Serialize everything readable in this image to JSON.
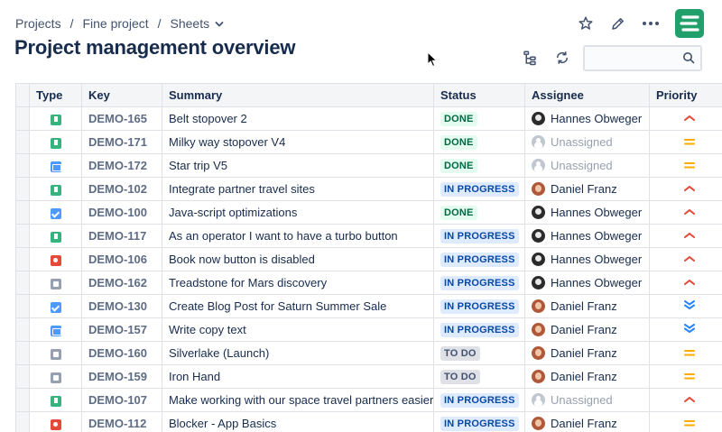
{
  "breadcrumb": {
    "projects": "Projects",
    "project": "Fine project",
    "sheets": "Sheets",
    "separator": "/"
  },
  "page_title": "Project management overview",
  "search": {
    "value": "",
    "placeholder": ""
  },
  "columns": {
    "type": "Type",
    "key": "Key",
    "summary": "Summary",
    "status": "Status",
    "assignee": "Assignee",
    "priority": "Priority"
  },
  "rows": [
    {
      "type": "story",
      "key": "DEMO-165",
      "summary": "Belt stopover 2",
      "status": "DONE",
      "assignee": "Hannes Obweger",
      "priority": "high"
    },
    {
      "type": "story",
      "key": "DEMO-171",
      "summary": "Milky way stopover V4",
      "status": "DONE",
      "assignee": "Unassigned",
      "priority": "medium"
    },
    {
      "type": "subtask",
      "key": "DEMO-172",
      "summary": "Star trip V5",
      "status": "DONE",
      "assignee": "Unassigned",
      "priority": "medium"
    },
    {
      "type": "story",
      "key": "DEMO-102",
      "summary": "Integrate partner travel sites",
      "status": "IN PROGRESS",
      "assignee": "Daniel Franz",
      "priority": "high"
    },
    {
      "type": "task",
      "key": "DEMO-100",
      "summary": "Java-script optimizations",
      "status": "DONE",
      "assignee": "Hannes Obweger",
      "priority": "high"
    },
    {
      "type": "story",
      "key": "DEMO-117",
      "summary": "As an operator I want to have a turbo button",
      "status": "IN PROGRESS",
      "assignee": "Hannes Obweger",
      "priority": "high"
    },
    {
      "type": "bug",
      "key": "DEMO-106",
      "summary": "Book now button is disabled",
      "status": "IN PROGRESS",
      "assignee": "Hannes Obweger",
      "priority": "high"
    },
    {
      "type": "epic",
      "key": "DEMO-162",
      "summary": "Treadstone for Mars discovery",
      "status": "IN PROGRESS",
      "assignee": "Hannes Obweger",
      "priority": "high"
    },
    {
      "type": "task",
      "key": "DEMO-130",
      "summary": "Create Blog Post for Saturn Summer Sale",
      "status": "IN PROGRESS",
      "assignee": "Daniel Franz",
      "priority": "lowest"
    },
    {
      "type": "subtask",
      "key": "DEMO-157",
      "summary": "Write copy text",
      "status": "IN PROGRESS",
      "assignee": "Daniel Franz",
      "priority": "lowest"
    },
    {
      "type": "epic",
      "key": "DEMO-160",
      "summary": "Silverlake (Launch)",
      "status": "TO DO",
      "assignee": "Daniel Franz",
      "priority": "medium"
    },
    {
      "type": "epic",
      "key": "DEMO-159",
      "summary": "Iron Hand",
      "status": "TO DO",
      "assignee": "Daniel Franz",
      "priority": "medium"
    },
    {
      "type": "story",
      "key": "DEMO-107",
      "summary": "Make working with our space travel partners easier",
      "status": "IN PROGRESS",
      "assignee": "Unassigned",
      "priority": "high"
    },
    {
      "type": "bug",
      "key": "DEMO-112",
      "summary": "Blocker - App Basics",
      "status": "IN PROGRESS",
      "assignee": "Daniel Franz",
      "priority": "medium"
    }
  ],
  "colors": {
    "accent": "#22a06b",
    "priority_high": "#e5493a",
    "priority_medium": "#ffab00",
    "priority_low": "#2684ff"
  },
  "icons": {
    "star": "star-icon",
    "edit": "pencil-icon",
    "more": "more-icon",
    "hierarchy": "hierarchy-icon",
    "refresh": "refresh-icon",
    "search": "search-icon",
    "logo": "sheets-logo-icon"
  }
}
